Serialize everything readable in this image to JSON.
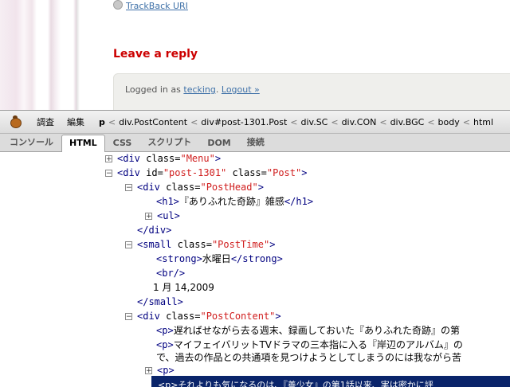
{
  "page": {
    "trackback_label": "TrackBack URI",
    "leave_reply": "Leave a reply",
    "logged_in_prefix": "Logged in as ",
    "username": "tecking",
    "logged_in_sep": ".",
    "logout": "Logout »"
  },
  "firebug": {
    "menu": {
      "inspect": "調査",
      "edit": "編集"
    },
    "breadcrumb": [
      "p",
      "div.PostContent",
      "div#post-1301.Post",
      "div.SC",
      "div.CON",
      "div.BGC",
      "body",
      "html"
    ],
    "tabs": [
      "コンソール",
      "HTML",
      "CSS",
      "スクリプト",
      "DOM",
      "接続"
    ],
    "active_tab": "HTML",
    "tree": {
      "menu_open": "<div ",
      "menu_attr": "class=",
      "menu_val": "\"Menu\"",
      "menu_close": ">",
      "post_open": "<div ",
      "post_id_attr": "id=",
      "post_id_val": "\"post-1301\"",
      "post_class_attr": " class=",
      "post_class_val": "\"Post\"",
      "post_close": ">",
      "head_open": "<div ",
      "head_attr": "class=",
      "head_val": "\"PostHead\"",
      "head_close": ">",
      "h1_open": "<h1>",
      "h1_text": "『ありふれた奇跡』雑感",
      "h1_close": "</h1>",
      "ul": "<ul>",
      "div_end": "</div>",
      "small_open": "<small ",
      "small_attr": "class=",
      "small_val": "\"PostTime\"",
      "small_close": ">",
      "strong_open": "<strong>",
      "strong_text": "水曜日",
      "strong_close": "</strong>",
      "br": "<br/>",
      "date": "1 月 14,2009",
      "small_end": "</small>",
      "content_open": "<div ",
      "content_attr": "class=",
      "content_val": "\"PostContent\"",
      "content_close": ">",
      "p1_tag": "<p>",
      "p1_text": "遅ればせながら去る週末、録画しておいた『ありふれた奇跡』の第",
      "p2_tag": "<p>",
      "p2_text": "マイフェイバリットTVドラマの三本指に入る『岸辺のアルバム』の",
      "p2_cont": "で、過去の作品との共通項を見つけようとしてしまうのには我ながら苦",
      "p3_tag": "<p>",
      "selected_text": "<p>それよりも気になるのは、『善少女』の第1話以来、実は密かに評"
    }
  }
}
